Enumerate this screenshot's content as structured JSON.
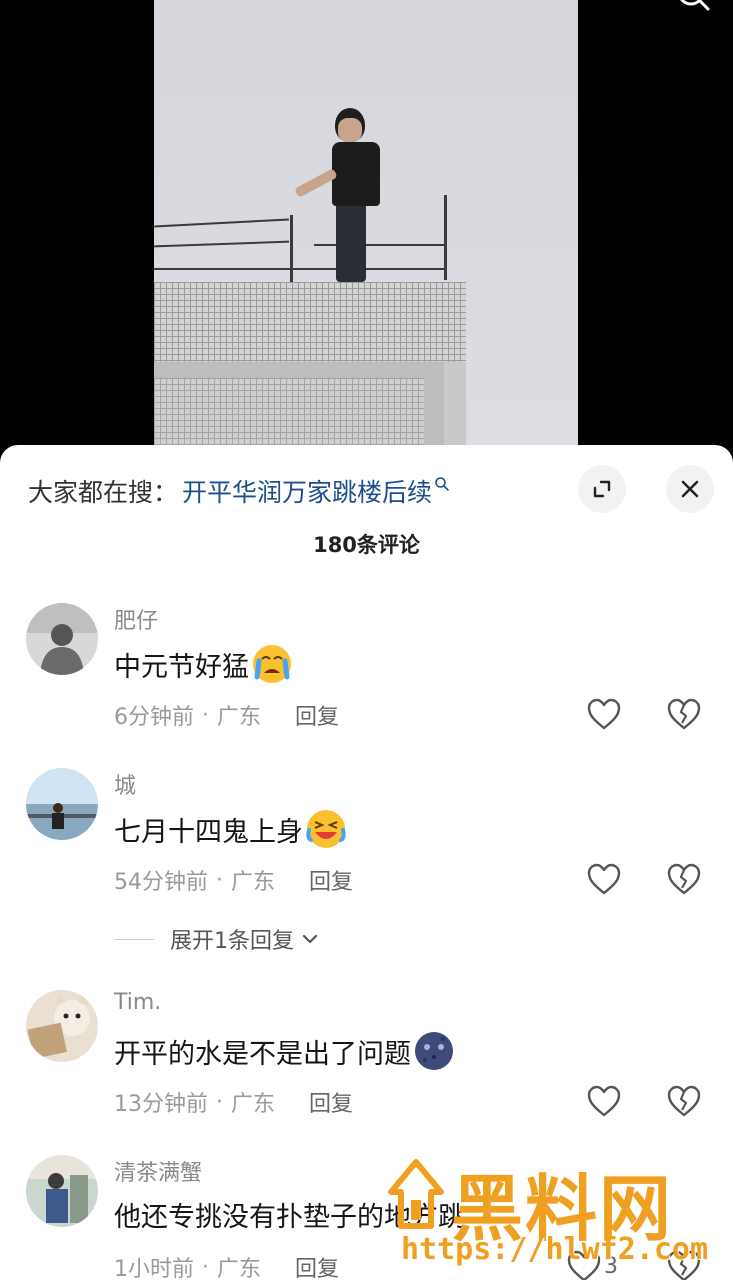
{
  "search": {
    "prefix": "大家都在搜：",
    "term": "开平华润万家跳楼后续"
  },
  "comment_count": "180条评论",
  "comments": [
    {
      "username": "肥仔",
      "text": "中元节好猛",
      "emoji": "crying-face-emoji",
      "time": "6分钟前",
      "location": "广东",
      "reply": "回复"
    },
    {
      "username": "城",
      "text": "七月十四鬼上身",
      "emoji": "laughing-crying-face-emoji",
      "time": "54分钟前",
      "location": "广东",
      "reply": "回复"
    },
    {
      "username": "Tim.",
      "text": "开平的水是不是出了问题",
      "emoji": "blue-moon-face-emoji",
      "time": "13分钟前",
      "location": "广东",
      "reply": "回复"
    },
    {
      "username": "清茶满蟹",
      "text": "他还专挑没有扑垫子的地方跳",
      "time": "1小时前",
      "location": "广东",
      "reply": "回复",
      "likes": "3"
    }
  ],
  "expand_replies": "展开1条回复",
  "separator": "·",
  "watermark": {
    "title": "黑料网",
    "url": "https://hlwf2.com"
  },
  "colors": {
    "search_term": "#1e4e8c",
    "watermark": "#f0a020"
  }
}
